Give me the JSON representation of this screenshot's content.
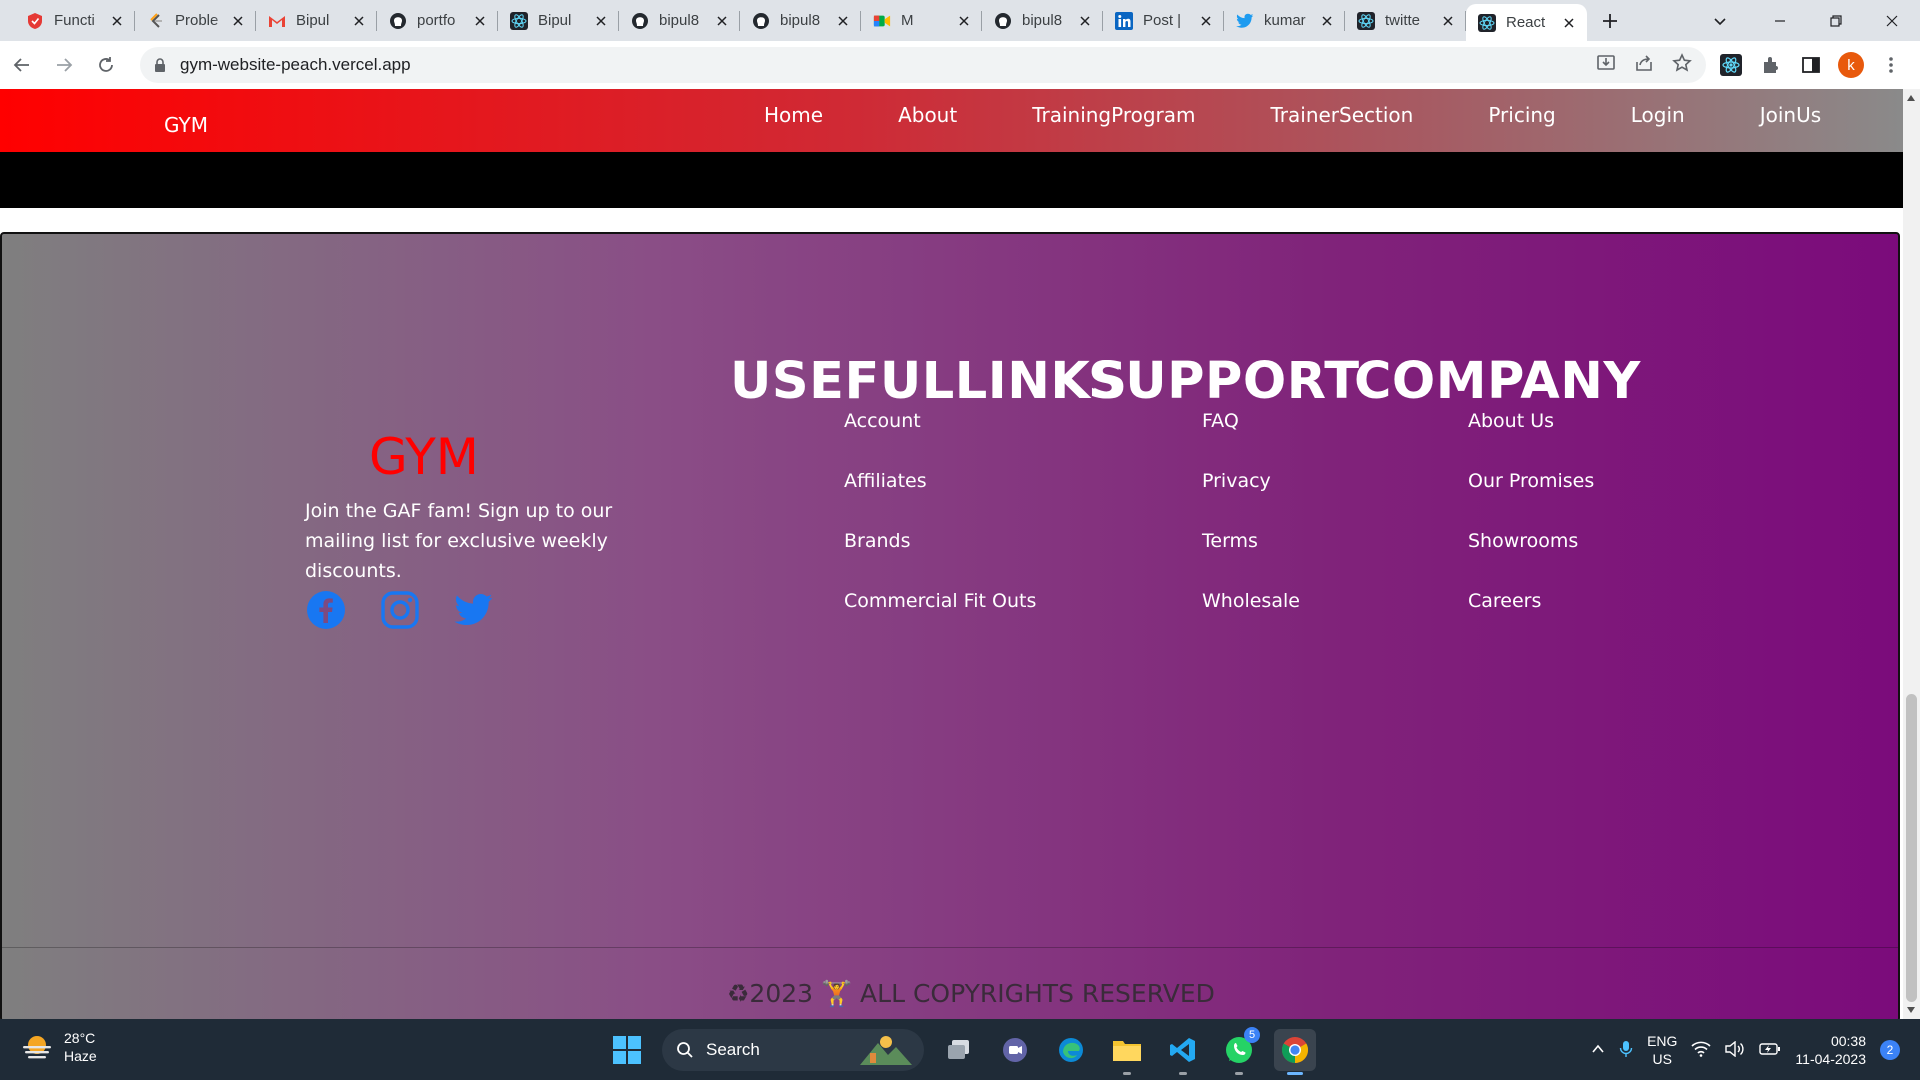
{
  "browser": {
    "tabs": [
      {
        "title": "Functi",
        "icon": "function-app-icon",
        "color": "#e53935"
      },
      {
        "title": "Proble",
        "icon": "code-c-icon",
        "color": "#ffa116"
      },
      {
        "title": "Bipul",
        "icon": "gmail-icon",
        "color": "#ea4335"
      },
      {
        "title": "portfo",
        "icon": "github-icon",
        "color": "#24292f"
      },
      {
        "title": "Bipul",
        "icon": "react-icon",
        "color": "#20232a"
      },
      {
        "title": "bipul8",
        "icon": "github-icon",
        "color": "#24292f"
      },
      {
        "title": "bipul8",
        "icon": "github-icon",
        "color": "#24292f"
      },
      {
        "title": "M",
        "icon": "google-meet-icon",
        "color": "#00897b"
      },
      {
        "title": "bipul8",
        "icon": "github-icon",
        "color": "#24292f"
      },
      {
        "title": "Post |",
        "icon": "linkedin-icon",
        "color": "#0a66c2"
      },
      {
        "title": "kumar",
        "icon": "twitter-icon",
        "color": "#1d9bf0"
      },
      {
        "title": "twitte",
        "icon": "react-icon",
        "color": "#20232a"
      },
      {
        "title": "React",
        "icon": "react-icon",
        "color": "#20232a",
        "active": true
      }
    ],
    "url": "gym-website-peach.vercel.app",
    "profile_initial": "k"
  },
  "site": {
    "logo": "GYM",
    "nav": [
      "Home",
      "About",
      "TrainingProgram",
      "TrainerSection",
      "Pricing",
      "Login",
      "JoinUs"
    ]
  },
  "footer": {
    "brand": "GYM",
    "tagline": "Join the GAF fam! Sign up to our mailing list for exclusive weekly discounts.",
    "social": [
      "facebook-icon",
      "instagram-icon",
      "twitter-icon"
    ],
    "columns": [
      {
        "heading": "USEFULLINKS",
        "links": [
          "Account",
          "Affiliates",
          "Brands",
          "Commercial Fit Outs"
        ]
      },
      {
        "heading": "SUPPORT",
        "links": [
          "FAQ",
          "Privacy",
          "Terms",
          "Wholesale"
        ]
      },
      {
        "heading": "COMPANY",
        "links": [
          "About Us",
          "Our Promises",
          "Showrooms",
          "Careers"
        ]
      }
    ],
    "copyright": "♻2023 🏋 ALL COPYRIGHTS RESERVED"
  },
  "taskbar": {
    "weather_temp": "28°C",
    "weather_desc": "Haze",
    "search_label": "Search",
    "whatsapp_badge": "5",
    "lang_1": "ENG",
    "lang_2": "US",
    "time": "00:38",
    "date": "11-04-2023",
    "notifications": "2"
  },
  "colors": {
    "nav_gradient_start": "#ff0000",
    "footer_gradient_end": "#7b0b7b",
    "brand_red": "#ff0000",
    "social_blue": "#1877f2"
  }
}
